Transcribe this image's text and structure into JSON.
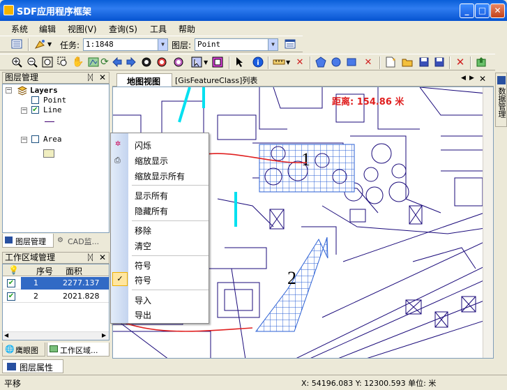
{
  "window": {
    "title": "SDF应用程序框架",
    "minimize": "_",
    "maximize": "□",
    "close": "✕"
  },
  "menu": [
    "系统",
    "编辑",
    "视图(V)",
    "查询(S)",
    "工具",
    "帮助"
  ],
  "toolbar1": {
    "task_label": "任务:",
    "task_value": "1:1848",
    "layer_label": "图层:",
    "layer_value": "Point"
  },
  "layer_panel": {
    "title": "图层管理",
    "pin": "ᛞ",
    "close": "✕",
    "root": "Layers",
    "layers": [
      {
        "name": "Point",
        "checked": false
      },
      {
        "name": "Line",
        "checked": true
      },
      {
        "name": "Area",
        "checked": false
      }
    ],
    "tabs": [
      "图层管理",
      "CAD监..."
    ]
  },
  "work_panel": {
    "title": "工作区域管理",
    "columns": [
      "序号",
      "面积"
    ],
    "rows": [
      {
        "id": "1",
        "area": "2277.137",
        "checked": true
      },
      {
        "id": "2",
        "area": "2021.828",
        "checked": true
      }
    ],
    "tabs": [
      "鹰眼图",
      "工作区域..."
    ]
  },
  "doc_tabs": [
    "地图视图",
    "[GisFeatureClass]列表"
  ],
  "right_dock": "数据管理",
  "map": {
    "distance_text": "距离: 154.86 米",
    "label1": "1",
    "label2": "2",
    "colors": {
      "line": "#1a0a7a",
      "cyan": "#00e0f0",
      "hatch": "#2a5fd4",
      "red": "#e02020"
    }
  },
  "context_menu": {
    "items": [
      "闪烁",
      "缩放显示",
      "缩放显示所有",
      "显示所有",
      "隐藏所有",
      "移除",
      "清空",
      "符号",
      "符号",
      "导入",
      "导出"
    ]
  },
  "bottom_tab": "图层属性",
  "status": {
    "mode": "平移",
    "coords": "X: 54196.083 Y: 12300.593 单位: 米"
  }
}
